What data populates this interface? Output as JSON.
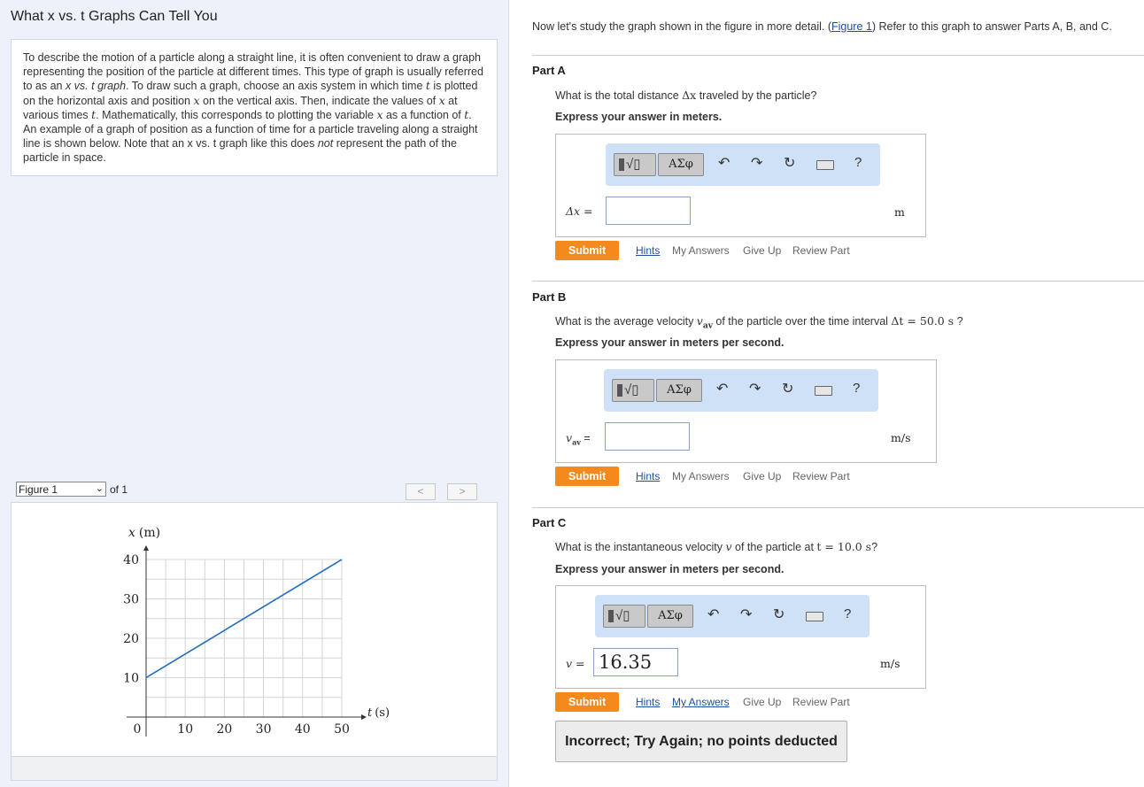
{
  "left": {
    "title": "What x vs. t Graphs Can Tell You",
    "intro": {
      "p1": "To describe the motion of a particle along a straight line, it is often convenient to draw a graph representing the position of the particle at different times. This type of graph is usually referred to as an ",
      "em1": "x vs. t graph",
      "p2": ". To draw such a graph, choose an axis system in which time ",
      "t1": "t",
      "p3": " is plotted on the horizontal axis and position ",
      "x1": "x",
      "p4": " on the vertical axis. Then, indicate the values of ",
      "x2": "x",
      "p5": " at various times ",
      "t2": "t",
      "p6": ". Mathematically, this corresponds to plotting the variable ",
      "x3": "x",
      "p7": " as a function of ",
      "t3": "t",
      "p8": ". An example of a graph of position as a function of time for a particle traveling along a straight line is shown below. Note that an x vs. t graph like this does ",
      "em2": "not",
      "p9": " represent the path of the particle in space."
    },
    "figure_nav": {
      "selected": "Figure 1",
      "of_label": "of 1",
      "prev": "<",
      "next": ">"
    }
  },
  "right": {
    "lead_text_before": "Now let's study the graph shown in the figure in more detail. (",
    "figure_link": "Figure 1",
    "lead_text_after": ") Refer to this graph to answer Parts A, B, and C.",
    "toolbar": {
      "templates_icon": "sqrt-template-icon",
      "symbols_label": "ΑΣφ",
      "undo_icon": "↶",
      "redo_icon": "↷",
      "reset_icon": "↻",
      "keyboard_icon": "keyboard-icon",
      "help_label": "?"
    },
    "actions": {
      "submit": "Submit",
      "hints": "Hints",
      "my_answers": "My Answers",
      "give_up": "Give Up",
      "review_part": "Review Part"
    },
    "parts": [
      {
        "title": "Part A",
        "question_before": "What is the total distance ",
        "question_sym": "Δx",
        "question_after": " traveled by the particle?",
        "instruction": "Express your answer in meters.",
        "input_label": "Δx =",
        "input_value": "",
        "unit": "m"
      },
      {
        "title": "Part B",
        "question_before": "What is the average velocity ",
        "question_sym": "v",
        "question_sub": "av",
        "question_mid": " of the particle over the time interval ",
        "question_math": "Δt = 50.0 s",
        "question_after": " ?",
        "instruction": "Express your answer in meters per second.",
        "input_label_sym": "v",
        "input_label_sub": "av",
        "input_label_eq": " =",
        "input_value": "",
        "unit": "m/s"
      },
      {
        "title": "Part C",
        "question_before": "What is the instantaneous velocity ",
        "question_sym": "v",
        "question_mid": " of the particle at ",
        "question_math": "t = 10.0 s",
        "question_after": "?",
        "instruction": "Express your answer in meters per second.",
        "input_label": "v =",
        "input_value": "16.35",
        "unit": "m/s",
        "feedback": "Incorrect; Try Again; no points deducted"
      }
    ]
  },
  "chart_data": {
    "type": "line",
    "xlabel_sym": "t",
    "xlabel_unit": "(s)",
    "ylabel_sym": "x",
    "ylabel_unit": "(m)",
    "xlim": [
      0,
      50
    ],
    "ylim": [
      0,
      40
    ],
    "x_ticks": [
      0,
      10,
      20,
      30,
      40,
      50
    ],
    "y_ticks": [
      10,
      20,
      30,
      40
    ],
    "grid": true,
    "minor_grid_step": 5,
    "series": [
      {
        "x": [
          0,
          50
        ],
        "y": [
          10,
          40
        ],
        "color": "#1f6fbf"
      }
    ]
  }
}
